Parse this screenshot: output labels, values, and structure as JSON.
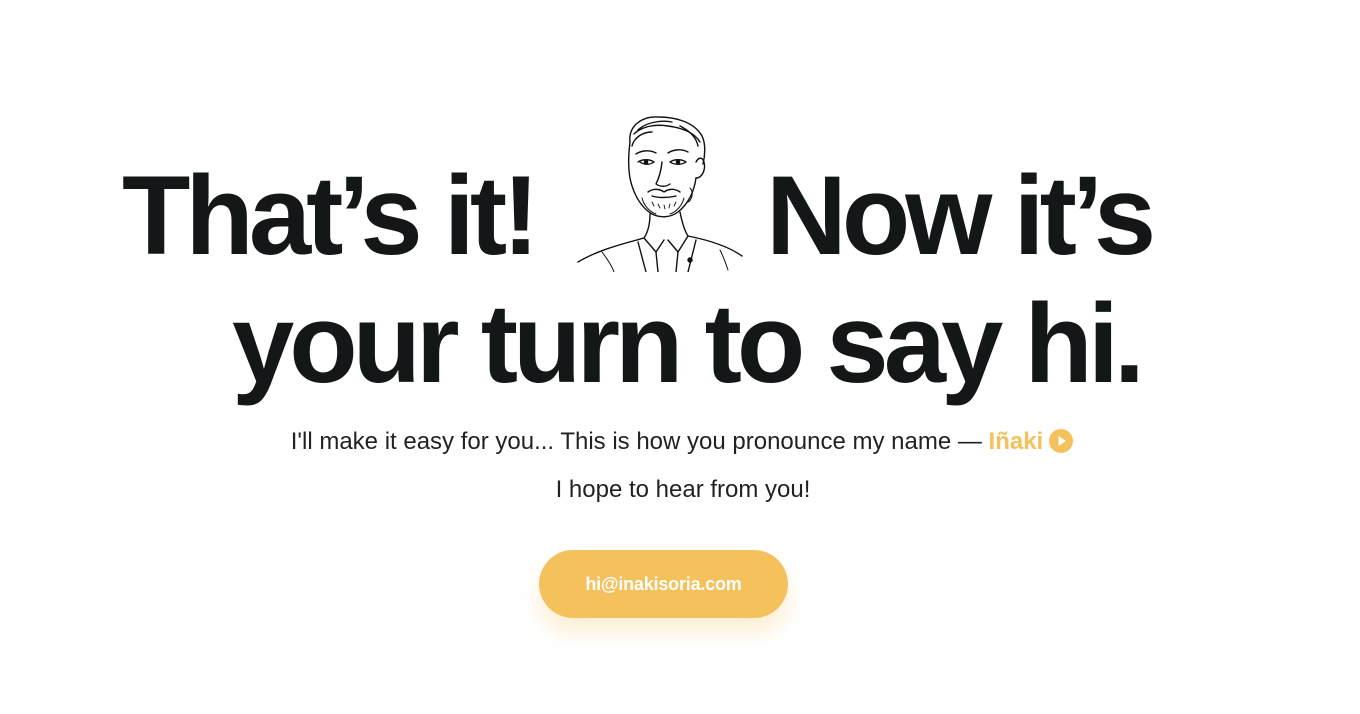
{
  "headline": {
    "line1_part1": "That’s it!",
    "line1_part2": "Now it’s",
    "line2": "your turn to say hi."
  },
  "intro": {
    "text": "I'll make it easy for you... This is how you pronounce my name — ",
    "name": "Iñaki",
    "play_icon": "play-circle-icon",
    "closing": "I hope to hear from you!"
  },
  "contact": {
    "email_label": "hi@inakisoria.com"
  },
  "colors": {
    "accent": "#f4c15d",
    "text": "#141718",
    "background": "#ffffff"
  }
}
